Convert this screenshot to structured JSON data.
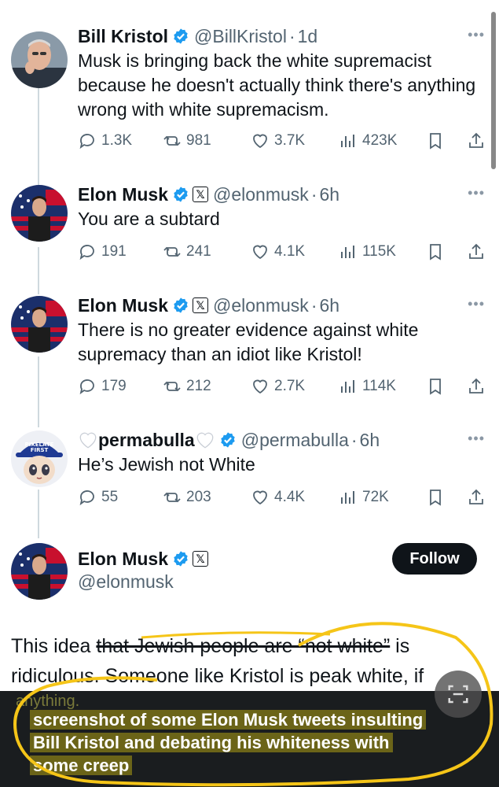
{
  "colors": {
    "verified": "#1d9bf0",
    "text": "#0f1419",
    "muted": "#536471",
    "highlight": "#f5c518",
    "caption_bg": "#6b6418"
  },
  "tweets": [
    {
      "name": "Bill Kristol",
      "handle": "@BillKristol",
      "time": "1d",
      "text": "Musk is bringing back the white supremacist because he doesn't actually think there's anything wrong with white supremacism.",
      "replies": "1.3K",
      "reposts": "981",
      "likes": "3.7K",
      "views": "423K"
    },
    {
      "name": "Elon Musk",
      "handle": "@elonmusk",
      "time": "6h",
      "text": "You are a subtard",
      "replies": "191",
      "reposts": "241",
      "likes": "4.1K",
      "views": "115K"
    },
    {
      "name": "Elon Musk",
      "handle": "@elonmusk",
      "time": "6h",
      "text": "There is no greater evidence against white supremacy than an idiot like Kristol!",
      "replies": "179",
      "reposts": "212",
      "likes": "2.7K",
      "views": "114K"
    },
    {
      "name": "permabulla",
      "handle": "@permabulla",
      "time": "6h",
      "text": "He’s Jewish not White",
      "replies": "55",
      "reposts": "203",
      "likes": "4.4K",
      "views": "72K",
      "avatar_cap_text": "PIXELATE FIRST"
    }
  ],
  "main_tweet": {
    "name": "Elon Musk",
    "handle": "@elonmusk",
    "follow_label": "Follow",
    "text_before": "This idea ",
    "text_struck": "that Jewish people are “not white”",
    "text_after": " is ridiculous. Someone like Kristol is peak white, if anything."
  },
  "caption": {
    "line1": "screenshot of some Elon Musk tweets insulting",
    "line2": "Bill Kristol and debating his whiteness with",
    "line3": "some creep"
  },
  "faint_text": "anything."
}
